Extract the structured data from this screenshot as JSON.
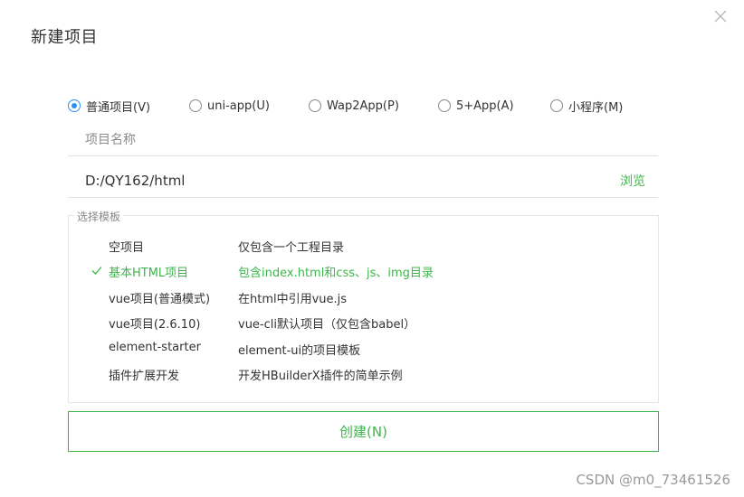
{
  "dialog": {
    "title": "新建项目",
    "close_icon": "close-icon"
  },
  "project_types": [
    {
      "label": "普通项目(V)",
      "checked": true
    },
    {
      "label": "uni-app(U)",
      "checked": false
    },
    {
      "label": "Wap2App(P)",
      "checked": false
    },
    {
      "label": "5+App(A)",
      "checked": false
    },
    {
      "label": "小程序(M)",
      "checked": false
    }
  ],
  "name_field": {
    "placeholder": "项目名称",
    "value": ""
  },
  "path_field": {
    "value": "D:/QY162/html",
    "browse_label": "浏览"
  },
  "templates": {
    "legend": "选择模板",
    "items": [
      {
        "name": "空项目",
        "desc": "仅包含一个工程目录",
        "selected": false
      },
      {
        "name": "基本HTML项目",
        "desc": "包含index.html和css、js、img目录",
        "selected": true
      },
      {
        "name": "vue项目(普通模式)",
        "desc": "在html中引用vue.js",
        "selected": false
      },
      {
        "name": "vue项目(2.6.10)",
        "desc": "vue-cli默认项目（仅包含babel）",
        "selected": false
      },
      {
        "name": "element-starter",
        "desc": "element-ui的项目模板",
        "selected": false
      },
      {
        "name": "插件扩展开发",
        "desc": "开发HBuilderX插件的简单示例",
        "selected": false
      }
    ]
  },
  "create_button": {
    "label": "创建(N)"
  },
  "watermark": "CSDN @m0_73461526",
  "colors": {
    "accent_green": "#3bb64a",
    "radio_blue": "#2f8ef4",
    "text": "#333333",
    "divider": "#e3e3e3"
  }
}
